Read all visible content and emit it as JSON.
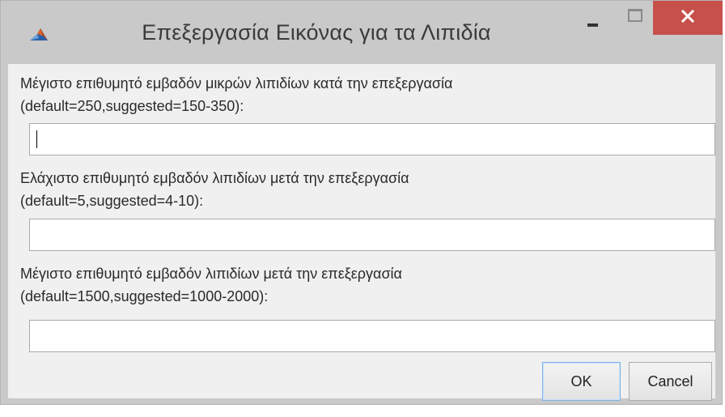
{
  "window": {
    "title": "Επεξεργασία Εικόνας για τα Λιπιδία",
    "icon": "matlab-icon",
    "controls": {
      "minimize": "minimize-icon",
      "maximize": "maximize-icon",
      "close": "close-icon"
    },
    "close_color": "#c7504b"
  },
  "fields": [
    {
      "prompt_line1": "Μέγιστο επιθυμητό εμβαδόν μικρών λιπιδίων κατά την επεξεργασία",
      "prompt_line2": "(default=250,suggested=150-350):",
      "value": "",
      "focused": true
    },
    {
      "prompt_line1": "Ελάχιστο επιθυμητό εμβαδόν λιπιδίων μετά την επεξεργασία",
      "prompt_line2": "(default=5,suggested=4-10):",
      "value": "",
      "focused": false
    },
    {
      "prompt_line1": "Μέγιστο επιθυμητό εμβαδόν λιπιδίων μετά την επεξεργασία",
      "prompt_line2": "(default=1500,suggested=1000-2000):",
      "value": "",
      "focused": false
    }
  ],
  "buttons": {
    "ok_label": "OK",
    "cancel_label": "Cancel"
  }
}
